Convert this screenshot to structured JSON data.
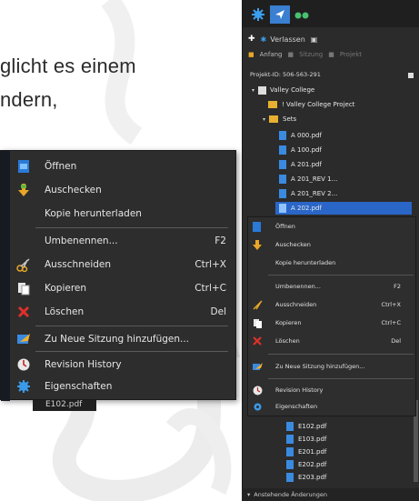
{
  "doc": {
    "line1": "glicht es einem",
    "line2": "ndern,"
  },
  "context_menu": {
    "items": [
      {
        "label": "Öffnen",
        "shortcut": "",
        "icon": "open-file-icon"
      },
      {
        "label": "Auschecken",
        "shortcut": "",
        "icon": "checkout-icon"
      },
      {
        "label": "Kopie herunterladen",
        "shortcut": "",
        "icon": ""
      },
      {
        "label": "Umbenennen...",
        "shortcut": "F2",
        "icon": ""
      },
      {
        "label": "Ausschneiden",
        "shortcut": "Ctrl+X",
        "icon": "scissors-icon"
      },
      {
        "label": "Kopieren",
        "shortcut": "Ctrl+C",
        "icon": "copy-icon"
      },
      {
        "label": "Löschen",
        "shortcut": "Del",
        "icon": "delete-icon"
      },
      {
        "label": "Zu Neue Sitzung hinzufügen...",
        "shortcut": "",
        "icon": "add-to-session-icon"
      },
      {
        "label": "Revision History",
        "shortcut": "",
        "icon": "history-icon"
      },
      {
        "label": "Eigenschaften",
        "shortcut": "",
        "icon": "properties-icon"
      }
    ],
    "below_text": "E102.pdf"
  },
  "panel": {
    "toolbar": {
      "leave": "Verlassen"
    },
    "toolbar2": {
      "home": "Anfang",
      "session": "Sitzung",
      "project": "Projekt"
    },
    "project_id": "Projekt-ID: 506-563-291",
    "tree": [
      {
        "label": "Valley College",
        "level": 0
      },
      {
        "label": "! Valley College Project",
        "level": 2
      },
      {
        "label": "Sets",
        "level": 1
      },
      {
        "label": "A 000.pdf",
        "level": 3
      },
      {
        "label": "A 100.pdf",
        "level": 3
      },
      {
        "label": "A 201.pdf",
        "level": 3
      },
      {
        "label": "A 201_REV 1...",
        "level": 3
      },
      {
        "label": "A 201_REV 2...",
        "level": 3
      },
      {
        "label": "A 202.pdf",
        "level": 3,
        "selected": true
      }
    ],
    "tree_bottom": [
      {
        "label": "E102.pdf"
      },
      {
        "label": "E103.pdf"
      },
      {
        "label": "E201.pdf"
      },
      {
        "label": "E202.pdf"
      },
      {
        "label": "E203.pdf"
      }
    ],
    "footer": "Anstehende Änderungen"
  },
  "colors": {
    "accent": "#2a66c8",
    "menu_bg": "#2d2d2d"
  }
}
